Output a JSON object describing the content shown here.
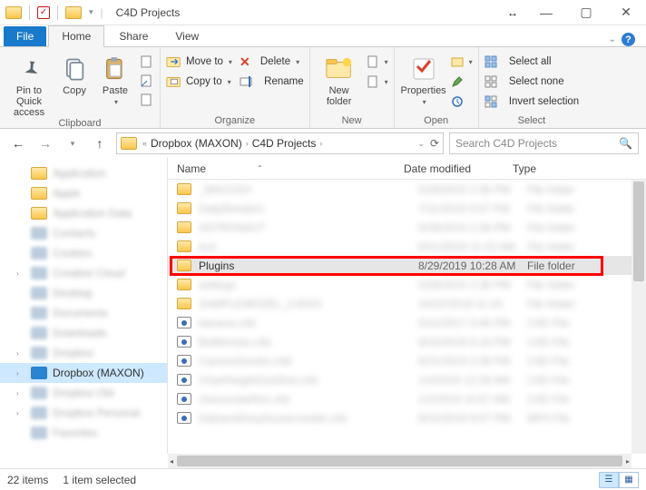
{
  "title": "C4D Projects",
  "tabs": {
    "file": "File",
    "home": "Home",
    "share": "Share",
    "view": "View"
  },
  "ribbon": {
    "clipboard": {
      "pin": "Pin to Quick access",
      "copy": "Copy",
      "paste": "Paste",
      "label": "Clipboard"
    },
    "organize": {
      "moveto": "Move to",
      "copyto": "Copy to",
      "delete": "Delete",
      "rename": "Rename",
      "label": "Organize"
    },
    "new": {
      "newfolder": "New folder",
      "label": "New"
    },
    "open": {
      "properties": "Properties",
      "label": "Open"
    },
    "select": {
      "selectall": "Select all",
      "selectnone": "Select none",
      "invert": "Invert selection",
      "label": "Select"
    }
  },
  "breadcrumb": {
    "seg1": "Dropbox (MAXON)",
    "seg2": "C4D Projects"
  },
  "search_placeholder": "Search C4D Projects",
  "columns": {
    "name": "Name",
    "date": "Date modified",
    "type": "Type"
  },
  "nav_selected": "Dropbox (MAXON)",
  "highlight_row": {
    "name": "Plugins",
    "date": "8/29/2019 10:28 AM",
    "type": "File folder"
  },
  "status": {
    "count": "22 items",
    "selected": "1 item selected"
  }
}
